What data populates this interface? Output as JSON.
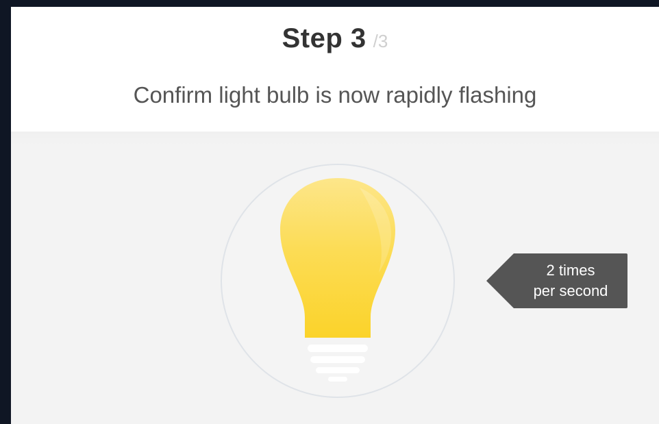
{
  "header": {
    "step_label": "Step 3",
    "step_total": "/3",
    "subtitle": "Confirm light bulb is now rapidly flashing"
  },
  "illustration": {
    "icon": "light-bulb-icon",
    "bulb_color": "#fcd73a",
    "tag": {
      "line1": "2 times",
      "line2": "per second",
      "background": "#555555"
    }
  },
  "colors": {
    "page_background": "#0f1624",
    "header_background": "#ffffff",
    "illustration_background": "#f3f3f3",
    "title_text": "#333333",
    "subtitle_text": "#555555"
  }
}
